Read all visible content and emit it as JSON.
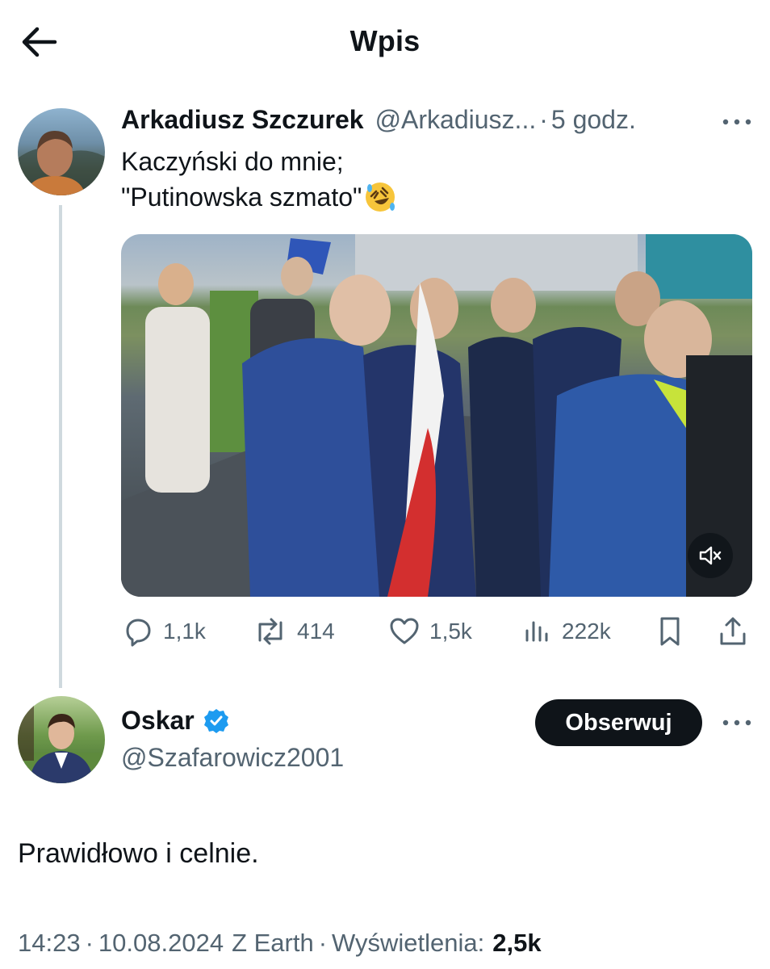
{
  "header": {
    "title": "Wpis"
  },
  "quoted_post": {
    "author": {
      "display_name": "Arkadiusz Szczurek",
      "handle": "@Arkadiusz...",
      "separator": "·",
      "time": "5 godz."
    },
    "text_lines": [
      "Kaczyński do mnie;",
      "\"Putinowska szmato\""
    ],
    "emoji": "rolling-on-floor-laughing-emoji",
    "media": {
      "type": "video",
      "muted": true
    },
    "actions": {
      "replies": "1,1k",
      "reposts": "414",
      "likes": "1,5k",
      "views": "222k"
    }
  },
  "reply_post": {
    "author": {
      "display_name": "Oskar",
      "handle": "@Szafarowicz2001",
      "verified": true
    },
    "follow_label": "Obserwuj",
    "text": "Prawidłowo i celnie.",
    "meta": {
      "time": "14:23",
      "separator1": "·",
      "date": "10.08.2024",
      "source": "Z Earth",
      "separator2": "·",
      "views_label": "Wyświetlenia:",
      "views_count": "2,5k"
    }
  },
  "colors": {
    "text_primary": "#0f1419",
    "text_secondary": "#536471",
    "verified_blue": "#1d9bf0",
    "thread_line": "#cfd9de"
  }
}
